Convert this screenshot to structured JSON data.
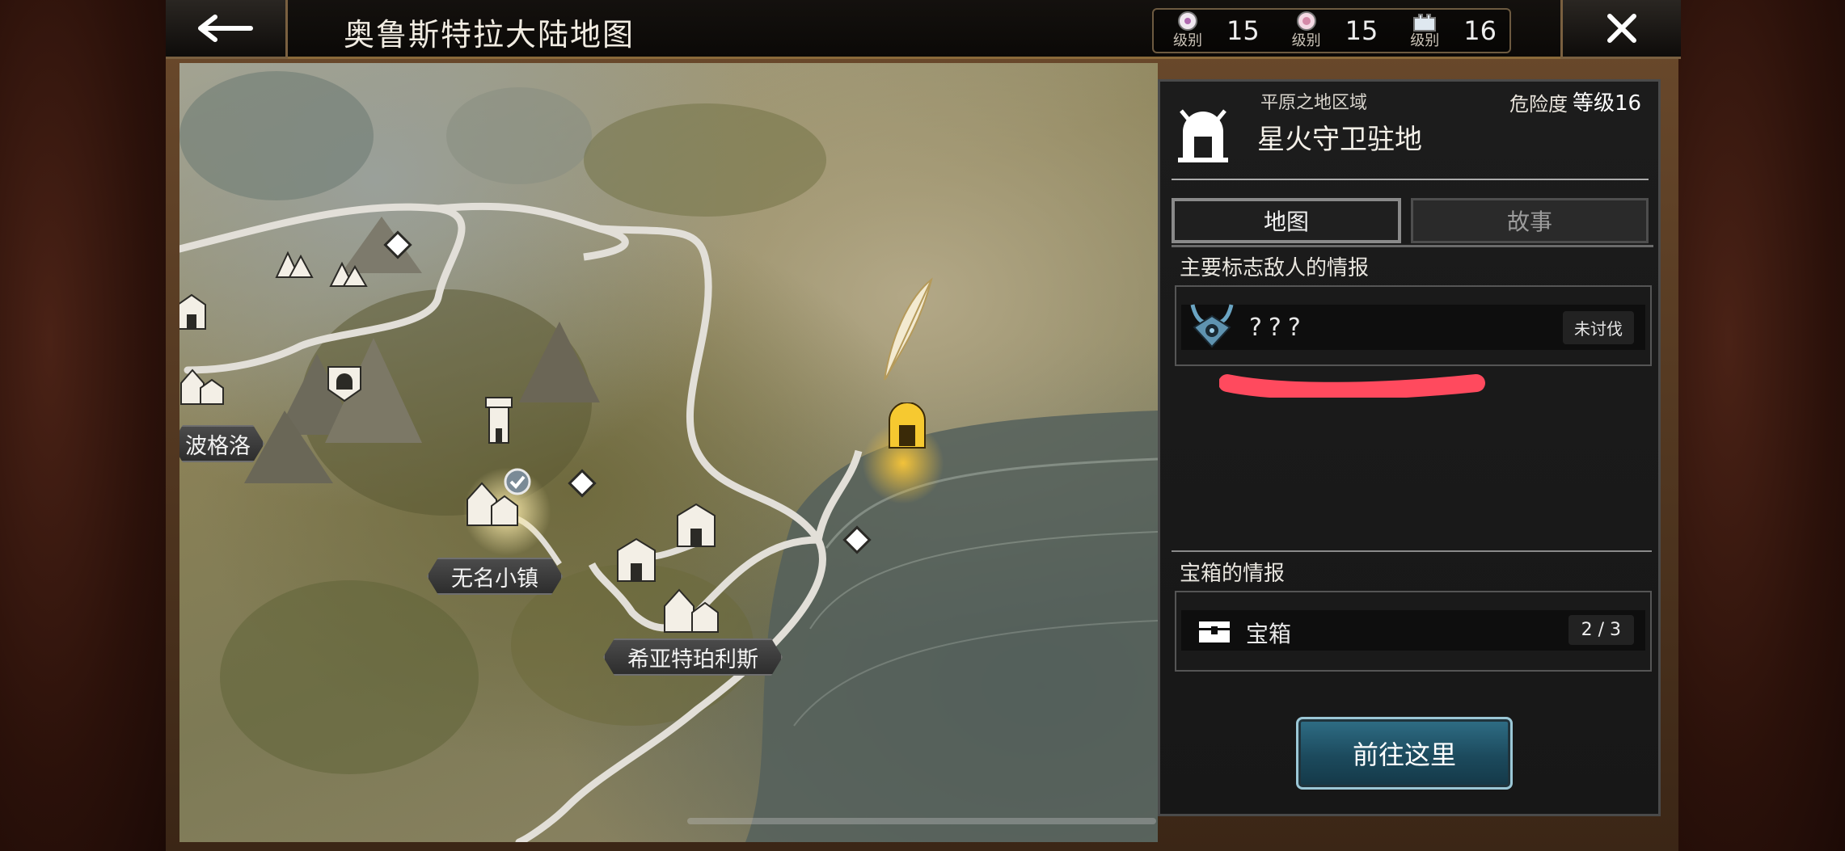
{
  "header": {
    "title": "奥鲁斯特拉大陆地图",
    "stats": [
      {
        "icon": "sakura-emblem-icon",
        "level_label": "级别",
        "value": "15"
      },
      {
        "icon": "flower-emblem-icon",
        "level_label": "级别",
        "value": "15"
      },
      {
        "icon": "castle-emblem-icon",
        "level_label": "级别",
        "value": "16"
      }
    ]
  },
  "map": {
    "labels": {
      "bogelo": "波格洛",
      "nameless_town": "无名小镇",
      "xiyatepolis": "希亚特珀利斯"
    }
  },
  "panel": {
    "region": "平原之地区域",
    "danger_label": "危险度",
    "danger_value": "等级16",
    "location_name": "星火守卫驻地",
    "tabs": {
      "map": "地图",
      "story": "故事"
    },
    "enemy_section_title": "主要标志敌人的情报",
    "enemy": {
      "name": "???",
      "status": "未讨伐"
    },
    "chest_section_title": "宝箱的情报",
    "chest": {
      "name": "宝箱",
      "count": "2 / 3"
    },
    "go_button": "前往这里"
  },
  "colors": {
    "accent_teal": "#2f6e86",
    "highlight_gold": "#f2c23a",
    "marker_red": "#ff4a5e"
  }
}
